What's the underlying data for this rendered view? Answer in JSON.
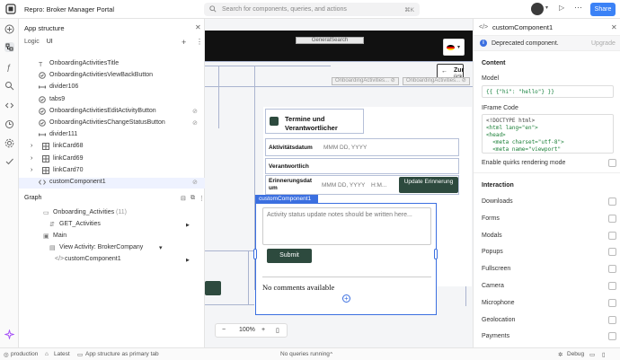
{
  "app": {
    "title": "Repro: Broker Manager Portal",
    "search_placeholder": "Search for components, queries, and actions",
    "search_shortcut": "⌘K",
    "share_label": "Share"
  },
  "structure": {
    "title": "App structure",
    "logic_label": "Logic",
    "ui_label": "UI",
    "items": [
      {
        "label": "OnboardingActivitiesTitle",
        "icon": "text-icon",
        "indent": 22
      },
      {
        "label": "OnboardingActivitiesViewBackButton",
        "icon": "button-icon",
        "indent": 22
      },
      {
        "label": "divider106",
        "icon": "divider-icon",
        "indent": 22
      },
      {
        "label": "tabs9",
        "icon": "tabs-icon",
        "indent": 22
      },
      {
        "label": "OnboardingActivitiesEditActivityButton",
        "icon": "button-icon",
        "indent": 22,
        "hidden": true
      },
      {
        "label": "OnboardingActivitiesChangeStatusButton",
        "icon": "button-icon",
        "indent": 22,
        "hidden": true
      },
      {
        "label": "divider111",
        "icon": "divider-icon",
        "indent": 22
      },
      {
        "label": "linkCard68",
        "icon": "grid-icon",
        "indent": 22,
        "collapsed": true
      },
      {
        "label": "linkCard69",
        "icon": "grid-icon",
        "indent": 22,
        "collapsed": true
      },
      {
        "label": "linkCard70",
        "icon": "grid-icon",
        "indent": 22,
        "collapsed": true
      },
      {
        "label": "customComponent1",
        "icon": "code-icon",
        "indent": 22,
        "selected": true,
        "hidden": true
      }
    ]
  },
  "graph": {
    "title": "Graph",
    "items": [
      {
        "label": "Onboarding_Activities",
        "count": "(11)",
        "indent": 27
      },
      {
        "label": "GET_Activities",
        "indent": 34
      },
      {
        "label": "Main",
        "indent": 27
      },
      {
        "label": "View Activity: BrokerCompany",
        "indent": 34
      },
      {
        "label": "customComponent1",
        "indent": 40
      }
    ]
  },
  "canvas": {
    "global_search_tag": "GeneralSearch",
    "zur_label": "Zur",
    "zur_label2": "ück",
    "tag1": "OnboardingActivities...",
    "tag2": "OnboardingActivities...",
    "card_title": "Termine und Verantwortlicher",
    "row1_label": "Aktivitätsdatum",
    "row1_value": "MMM DD, YYYY",
    "row2_label": "Verantwortlich",
    "row3_label": "Erinnerungsdat um",
    "row3_value": "MMM DD, YYYY",
    "row3_time": "H:M...",
    "update_button": "Update Erinnerung",
    "selected_tag": "customComponent1",
    "textarea_placeholder": "Activity status update notes should be written here...",
    "submit_label": "Submit",
    "no_comments": "No comments available",
    "zoom": "100%"
  },
  "inspector": {
    "component_name": "customComponent1",
    "deprecated_text": "Deprecated component.",
    "upgrade_label": "Upgrade",
    "content_title": "Content",
    "model_label": "Model",
    "model_value": "{{ {\"hi\": \"hello\"} }}",
    "iframe_label": "IFrame Code",
    "iframe_code": [
      "<!DOCTYPE html>",
      "<html lang=\"en\">",
      "<head>",
      "  <meta charset=\"utf-8\">",
      "  <meta name=\"viewport\""
    ],
    "quirks_label": "Enable quirks rendering mode",
    "interaction_title": "Interaction",
    "interactions": [
      "Downloads",
      "Forms",
      "Modals",
      "Popups",
      "Fullscreen",
      "Camera",
      "Microphone",
      "Geolocation",
      "Payments"
    ]
  },
  "statusbar": {
    "env": "production",
    "version": "Latest",
    "tab_label": "App structure as primary tab",
    "queries": "No queries running",
    "debug": "Debug"
  },
  "colors": {
    "accent": "#3b82f6",
    "selection": "#3b6fe0",
    "primary_button": "#2d4a3e"
  }
}
